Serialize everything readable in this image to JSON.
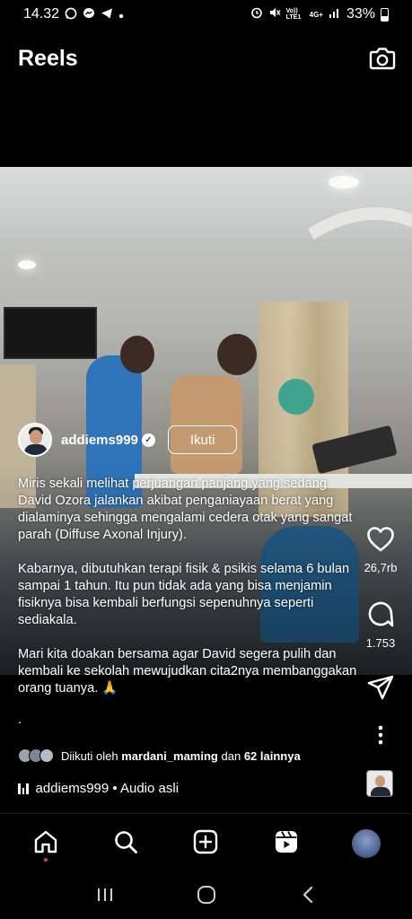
{
  "status_bar": {
    "time": "14.32",
    "left_icons": [
      "whatsapp-icon",
      "messenger-icon",
      "telegram-icon",
      "dot-icon"
    ],
    "right_icons": [
      "alarm-icon",
      "mute-icon",
      "volte-icon",
      "network-4g-icon",
      "signal-icon"
    ],
    "volte_label": "Vo)) LTE1",
    "network_label": "4G+",
    "battery_percent": "33%"
  },
  "header": {
    "title": "Reels",
    "camera_icon": "camera-icon"
  },
  "reel": {
    "author": {
      "username": "addiems999",
      "verified": true,
      "follow_label": "Ikuti"
    },
    "caption": {
      "paragraph1": "Miris sekali melihat perjuangan panjang yang sedang David Ozora jalankan akibat penganiayaan berat yang dialaminya sehingga mengalami cedera otak yang sangat parah (Diffuse Axonal Injury).",
      "paragraph2": "Kabarnya, dibutuhkan terapi fisik & psikis selama 6 bulan sampai 1 tahun. Itu pun tidak ada yang bisa menjamin fisiknya bisa kembali berfungsi sepenuhnya seperti sediakala.",
      "paragraph3": "Mari kita doakan bersama agar David segera pulih dan kembali ke sekolah mewujudkan cita2nya membanggakan orang tuanya. 🙏",
      "trailing": "."
    },
    "actions": {
      "like_count": "26,7rb",
      "comment_count": "1.753",
      "like_icon": "heart-icon",
      "comment_icon": "comment-icon",
      "share_icon": "send-icon",
      "more_icon": "more-vertical-icon"
    },
    "followers": {
      "prefix": "Diikuti oleh",
      "user": "mardani_maming",
      "connector": "dan",
      "others": "62 lainnya"
    },
    "audio": {
      "label": "addiems999 • Audio asli"
    }
  },
  "bottom_nav": {
    "items": [
      "home-icon",
      "search-icon",
      "create-icon",
      "reels-icon",
      "profile-avatar"
    ],
    "active": "home-icon"
  },
  "system_nav": [
    "recent-apps-icon",
    "home-circle-icon",
    "back-icon"
  ],
  "colors": {
    "background": "#000000",
    "text": "#ffffff",
    "notification_dot": "#ff3040"
  }
}
